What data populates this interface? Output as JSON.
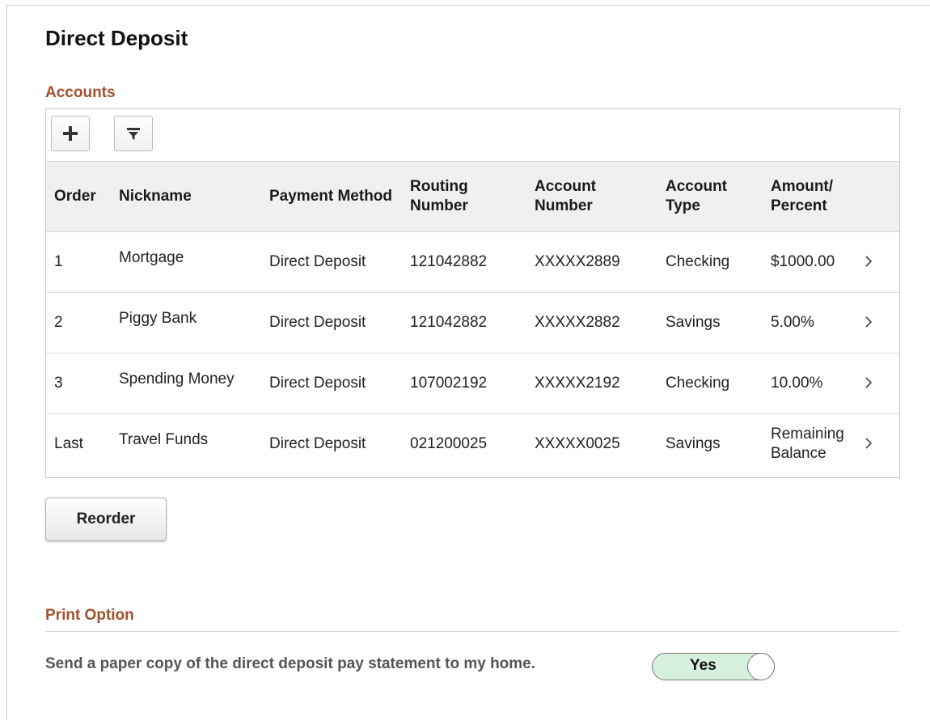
{
  "page": {
    "title": "Direct Deposit"
  },
  "accounts": {
    "section_title": "Accounts",
    "toolbar": {
      "add_icon": "plus-icon",
      "filter_icon": "filter-icon"
    },
    "columns": [
      "Order",
      "Nickname",
      "Payment Method",
      "Routing Number",
      "Account Number",
      "Account Type",
      "Amount/ Percent"
    ],
    "rows": [
      {
        "order": "1",
        "nickname": "Mortgage",
        "payment_method": "Direct Deposit",
        "routing_number": "121042882",
        "account_number": "XXXXX2889",
        "account_type": "Checking",
        "amount": "$1000.00"
      },
      {
        "order": "2",
        "nickname": "Piggy Bank",
        "payment_method": "Direct Deposit",
        "routing_number": "121042882",
        "account_number": "XXXXX2882",
        "account_type": "Savings",
        "amount": "5.00%"
      },
      {
        "order": "3",
        "nickname": "Spending Money",
        "payment_method": "Direct Deposit",
        "routing_number": "107002192",
        "account_number": "XXXXX2192",
        "account_type": "Checking",
        "amount": "10.00%"
      },
      {
        "order": "Last",
        "nickname": "Travel Funds",
        "payment_method": "Direct Deposit",
        "routing_number": "021200025",
        "account_number": "XXXXX0025",
        "account_type": "Savings",
        "amount": "Remaining Balance"
      }
    ],
    "reorder_label": "Reorder"
  },
  "print_option": {
    "section_title": "Print Option",
    "label": "Send a paper copy of the direct deposit pay statement to my home.",
    "toggle_value": "Yes"
  },
  "colors": {
    "section_title": "#a0522d",
    "toggle_on": "#d6f0de"
  }
}
